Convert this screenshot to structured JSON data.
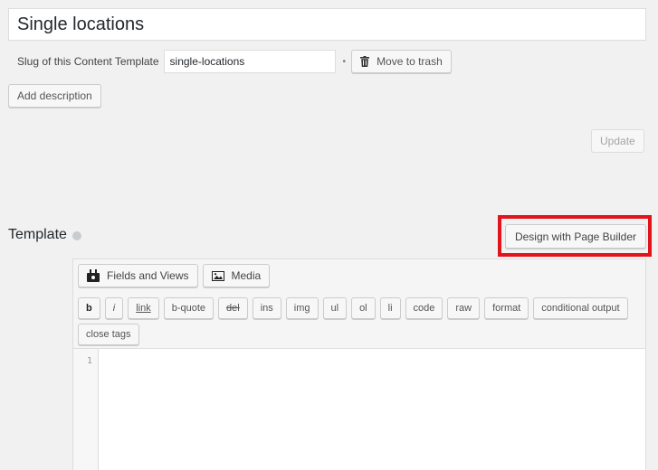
{
  "title": {
    "value": "Single locations"
  },
  "slug": {
    "label": "Slug of this Content Template",
    "value": "single-locations",
    "separator": "•",
    "trash_label": "Move to trash"
  },
  "add_description_label": "Add description",
  "update_label": "Update",
  "template": {
    "heading": "Template",
    "page_builder_label": "Design with Page Builder"
  },
  "editor": {
    "fields_views_label": "Fields and Views",
    "media_label": "Media",
    "quicktags": [
      "b",
      "i",
      "link",
      "b-quote",
      "del",
      "ins",
      "img",
      "ul",
      "ol",
      "li",
      "code",
      "raw",
      "format",
      "conditional output",
      "close tags"
    ],
    "line_numbers": [
      "1"
    ]
  },
  "colors": {
    "highlight": "#e2131b",
    "background": "#f1f1f1"
  }
}
